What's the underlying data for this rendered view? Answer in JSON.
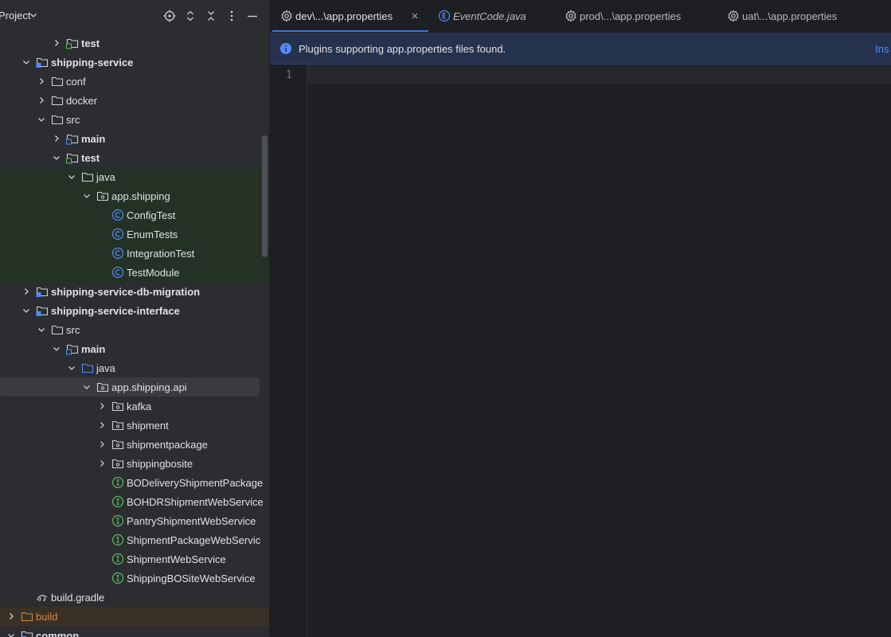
{
  "project_panel": {
    "title": "Project",
    "header_buttons": [
      "locate-icon",
      "expand-collapse-icon",
      "collapse-all-icon",
      "more-options-icon",
      "hide-icon"
    ],
    "tree": [
      {
        "label": "test",
        "icon": "test-folder-icon",
        "depth": 3,
        "chevron": "right",
        "bold": true
      },
      {
        "label": "shipping-service",
        "icon": "module-icon",
        "depth": 1,
        "chevron": "down",
        "bold": true
      },
      {
        "label": "conf",
        "icon": "folder-icon",
        "depth": 2,
        "chevron": "right"
      },
      {
        "label": "docker",
        "icon": "folder-icon",
        "depth": 2,
        "chevron": "right"
      },
      {
        "label": "src",
        "icon": "folder-icon",
        "depth": 2,
        "chevron": "down"
      },
      {
        "label": "main",
        "icon": "source-folder-icon",
        "depth": 3,
        "chevron": "right",
        "bold": true
      },
      {
        "label": "test",
        "icon": "test-folder-icon",
        "depth": 3,
        "chevron": "down",
        "bold": true
      },
      {
        "label": "java",
        "icon": "folder-icon",
        "depth": 4,
        "chevron": "down",
        "bg": "test"
      },
      {
        "label": "app.shipping",
        "icon": "package-icon",
        "depth": 5,
        "chevron": "down",
        "bg": "test"
      },
      {
        "label": "ConfigTest",
        "icon": "class-icon",
        "depth": 6,
        "bg": "test"
      },
      {
        "label": "EnumTests",
        "icon": "class-icon",
        "depth": 6,
        "bg": "test"
      },
      {
        "label": "IntegrationTest",
        "icon": "class-icon",
        "depth": 6,
        "bg": "test"
      },
      {
        "label": "TestModule",
        "icon": "class-icon",
        "depth": 6,
        "bg": "test"
      },
      {
        "label": "shipping-service-db-migration",
        "icon": "module-icon",
        "depth": 1,
        "chevron": "right",
        "bold": true
      },
      {
        "label": "shipping-service-interface",
        "icon": "module-icon",
        "depth": 1,
        "chevron": "down",
        "bold": true
      },
      {
        "label": "src",
        "icon": "folder-icon",
        "depth": 2,
        "chevron": "down"
      },
      {
        "label": "main",
        "icon": "source-folder-icon",
        "depth": 3,
        "chevron": "down",
        "bold": true
      },
      {
        "label": "java",
        "icon": "source-root-icon",
        "depth": 4,
        "chevron": "down"
      },
      {
        "label": "app.shipping.api",
        "icon": "package-icon",
        "depth": 5,
        "chevron": "down",
        "selected": true
      },
      {
        "label": "kafka",
        "icon": "package-icon",
        "depth": 6,
        "chevron": "right"
      },
      {
        "label": "shipment",
        "icon": "package-icon",
        "depth": 6,
        "chevron": "right"
      },
      {
        "label": "shipmentpackage",
        "icon": "package-icon",
        "depth": 6,
        "chevron": "right"
      },
      {
        "label": "shippingbosite",
        "icon": "package-icon",
        "depth": 6,
        "chevron": "right"
      },
      {
        "label": "BODeliveryShipmentPackage",
        "icon": "interface-icon",
        "depth": 6
      },
      {
        "label": "BOHDRShipmentWebService",
        "icon": "interface-icon",
        "depth": 6
      },
      {
        "label": "PantryShipmentWebService",
        "icon": "interface-icon",
        "depth": 6
      },
      {
        "label": "ShipmentPackageWebServic",
        "icon": "interface-icon",
        "depth": 6
      },
      {
        "label": "ShipmentWebService",
        "icon": "interface-icon",
        "depth": 6
      },
      {
        "label": "ShippingBOSiteWebService",
        "icon": "interface-icon",
        "depth": 6
      },
      {
        "label": "build.gradle",
        "icon": "gradle-icon",
        "depth": 1
      },
      {
        "label": "build",
        "icon": "excluded-folder-icon",
        "depth": 0,
        "chevron": "right",
        "bg": "build",
        "orange": true
      },
      {
        "label": "common",
        "icon": "module-icon",
        "depth": 0,
        "chevron": "down",
        "bold": true
      }
    ]
  },
  "editor": {
    "tabs": [
      {
        "label": "dev\\...\\app.properties",
        "icon": "gear-icon",
        "active": true,
        "closable": true
      },
      {
        "label": "EventCode.java",
        "icon": "enum-icon",
        "italic": true
      },
      {
        "label": "prod\\...\\app.properties",
        "icon": "gear-icon"
      },
      {
        "label": "uat\\...\\app.properties",
        "icon": "gear-icon"
      }
    ],
    "banner": {
      "text": "Plugins supporting app.properties files found.",
      "action": "Ins"
    },
    "line_numbers": [
      "1"
    ]
  },
  "colors": {
    "accent": "#3574f0",
    "class_icon": "#548af7",
    "interface_icon": "#5fb865",
    "test_bg": "#243226",
    "excluded": "#c9874a"
  }
}
